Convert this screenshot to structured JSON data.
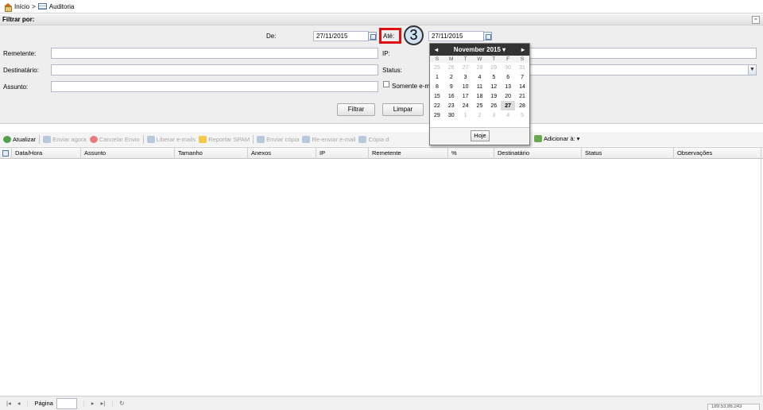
{
  "breadcrumb": {
    "home": "Início",
    "separator": ">",
    "current": "Auditoria"
  },
  "filter": {
    "title": "Filtrar por:",
    "de_label": "De:",
    "de_value": "27/11/2015",
    "ate_label": "Até:",
    "ate_value": "27/11/2015",
    "remetente_label": "Remetente:",
    "destinatario_label": "Destinatário:",
    "assunto_label": "Assunto:",
    "ip_label": "IP:",
    "status_label": "Status:",
    "somente_label": "Somente e-m",
    "filtrar_button": "Filtrar",
    "limpar_button": "Limpar"
  },
  "step_marker": "3",
  "calendar": {
    "month_label": "November 2015",
    "weekdays": [
      "S",
      "M",
      "T",
      "W",
      "T",
      "F",
      "S"
    ],
    "weeks": [
      [
        "25",
        "26",
        "27",
        "28",
        "29",
        "30",
        "31"
      ],
      [
        "1",
        "2",
        "3",
        "4",
        "5",
        "6",
        "7"
      ],
      [
        "8",
        "9",
        "10",
        "11",
        "12",
        "13",
        "14"
      ],
      [
        "15",
        "16",
        "17",
        "18",
        "19",
        "20",
        "21"
      ],
      [
        "22",
        "23",
        "24",
        "25",
        "26",
        "27",
        "28"
      ],
      [
        "29",
        "30",
        "1",
        "2",
        "3",
        "4",
        "5"
      ]
    ],
    "today_button": "Hoje"
  },
  "toolbar": {
    "atualizar": "Atualizar",
    "enviar_agora": "Enviar agora",
    "cancelar_envio": "Cancelar Envio",
    "liberar_emails": "Liberar e-mails",
    "reportar_spam": "Reportar SPAM",
    "enviar_copia": "Enviar cópia",
    "reenviar_email": "Re-enviar e-mail",
    "copia": "Cópia d",
    "adicionar": "Adicionar à:"
  },
  "grid": {
    "columns": [
      "Data/Hora",
      "Assunto",
      "Tamanho",
      "Anexos",
      "IP",
      "Remetente",
      "%",
      "Destinatário",
      "Status",
      "Observações"
    ]
  },
  "pager": {
    "page_label": "Página"
  },
  "ip_footer": "189.53.86.243",
  "colors": {
    "highlight": "#e01010",
    "calendar_header": "#333333",
    "step_circle": "#cfe3f5"
  }
}
